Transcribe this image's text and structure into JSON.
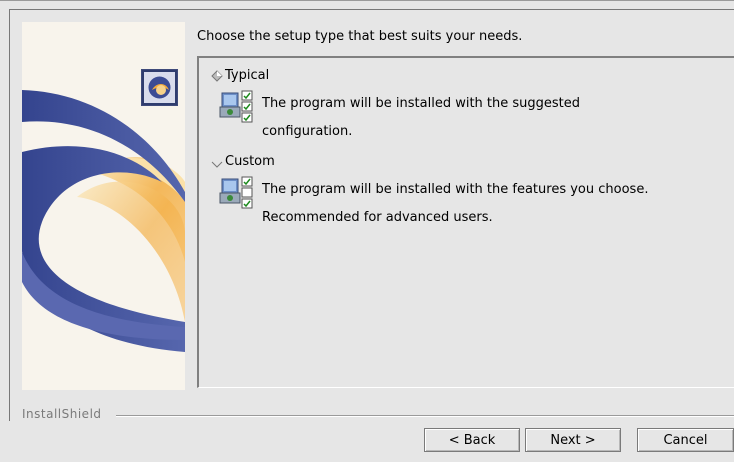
{
  "instruction": "Choose the setup type that best suits your needs.",
  "options": [
    {
      "label": "Typical",
      "selected": true,
      "description_lines": [
        "The program will be installed with the suggested",
        "configuration."
      ],
      "icon": "setup-computer-icon"
    },
    {
      "label": "Custom",
      "selected": false,
      "description_lines": [
        "The program will be installed with the features you choose.",
        "Recommended for advanced users."
      ],
      "icon": "setup-computer-icon"
    }
  ],
  "brand": "InstallShield",
  "buttons": {
    "back": "< Back",
    "next": "Next >",
    "cancel": "Cancel"
  },
  "colors": {
    "background": "#e6e6e6",
    "swoosh_blue": "#3e4f9a",
    "swoosh_orange": "#f2a93b"
  }
}
